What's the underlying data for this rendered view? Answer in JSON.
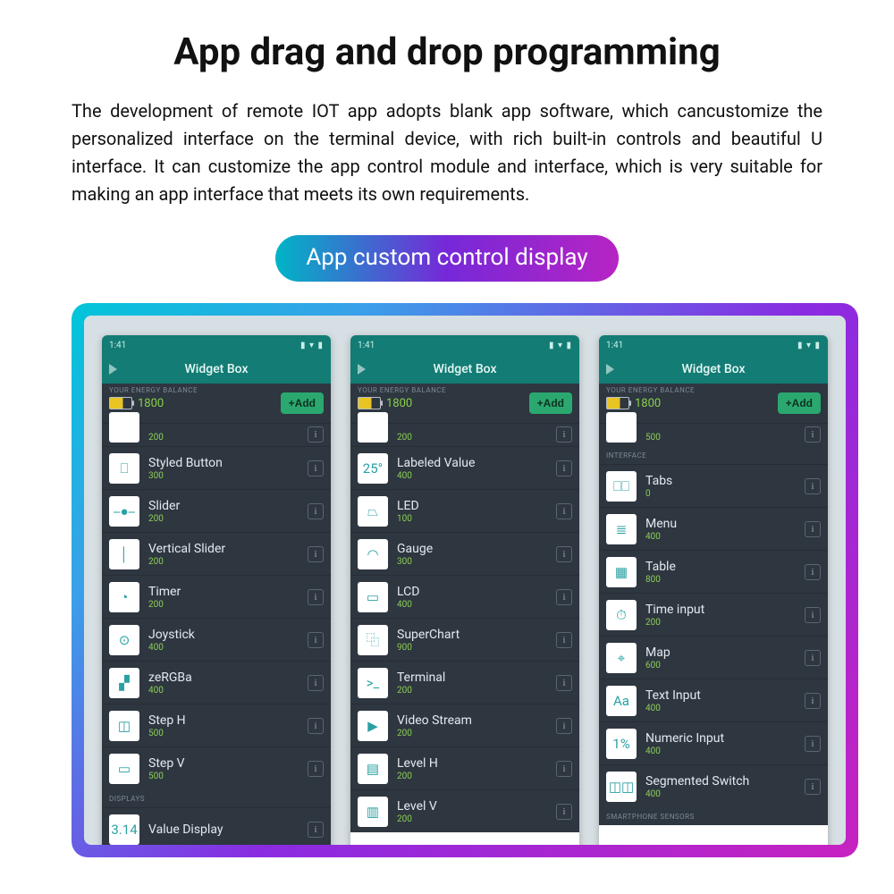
{
  "heading": "App drag and drop programming",
  "description": "The development of remote IOT app adopts blank app software, which cancustomize the personalized interface on the terminal device, with rich built-in controls and beautiful U interface. It can customize the app control module and interface, which is very suitable for making an app interface that meets its own requirements.",
  "pill_label": "App custom control display",
  "common": {
    "status_time": "1:41",
    "app_title": "Widget Box",
    "energy_section_label": "YOUR ENERGY BALANCE",
    "energy_value": "1800",
    "add_button": "+Add",
    "info_glyph": "i"
  },
  "screens": [
    {
      "half_cost": "200",
      "items": [
        {
          "title": "Styled Button",
          "cost": "300",
          "glyph": "⎕"
        },
        {
          "title": "Slider",
          "cost": "200",
          "glyph": "⎯●⎯"
        },
        {
          "title": "Vertical Slider",
          "cost": "200",
          "glyph": "│"
        },
        {
          "title": "Timer",
          "cost": "200",
          "glyph": "◔"
        },
        {
          "title": "Joystick",
          "cost": "400",
          "glyph": "⊙"
        },
        {
          "title": "zeRGBa",
          "cost": "400",
          "glyph": "▞"
        },
        {
          "title": "Step H",
          "cost": "500",
          "glyph": "◫"
        },
        {
          "title": "Step V",
          "cost": "500",
          "glyph": "▭"
        }
      ],
      "section_after": "DISPLAYS",
      "tail_item": {
        "title": "Value Display",
        "cost": "",
        "glyph": "3.14"
      }
    },
    {
      "half_cost": "200",
      "items": [
        {
          "title": "Labeled Value",
          "cost": "400",
          "glyph": "25°"
        },
        {
          "title": "LED",
          "cost": "100",
          "glyph": "⏢"
        },
        {
          "title": "Gauge",
          "cost": "300",
          "glyph": "◠"
        },
        {
          "title": "LCD",
          "cost": "400",
          "glyph": "▭"
        },
        {
          "title": "SuperChart",
          "cost": "900",
          "glyph": "⿻"
        },
        {
          "title": "Terminal",
          "cost": "200",
          "glyph": ">_"
        },
        {
          "title": "Video Stream",
          "cost": "200",
          "glyph": "▶"
        },
        {
          "title": "Level H",
          "cost": "200",
          "glyph": "▤"
        },
        {
          "title": "Level V",
          "cost": "200",
          "glyph": "▥"
        }
      ],
      "section_after": "",
      "tail_item": null
    },
    {
      "half_cost": "500",
      "section_before": "INTERFACE",
      "items": [
        {
          "title": "Tabs",
          "cost": "0",
          "glyph": "⎕⎕"
        },
        {
          "title": "Menu",
          "cost": "400",
          "glyph": "≣"
        },
        {
          "title": "Table",
          "cost": "800",
          "glyph": "▦"
        },
        {
          "title": "Time input",
          "cost": "200",
          "glyph": "⏱"
        },
        {
          "title": "Map",
          "cost": "600",
          "glyph": "⌖"
        },
        {
          "title": "Text Input",
          "cost": "400",
          "glyph": "Aa"
        },
        {
          "title": "Numeric Input",
          "cost": "400",
          "glyph": "1%"
        },
        {
          "title": "Segmented Switch",
          "cost": "400",
          "glyph": "◫◫"
        }
      ],
      "section_after": "SMARTPHONE SENSORS",
      "tail_item": null
    }
  ]
}
